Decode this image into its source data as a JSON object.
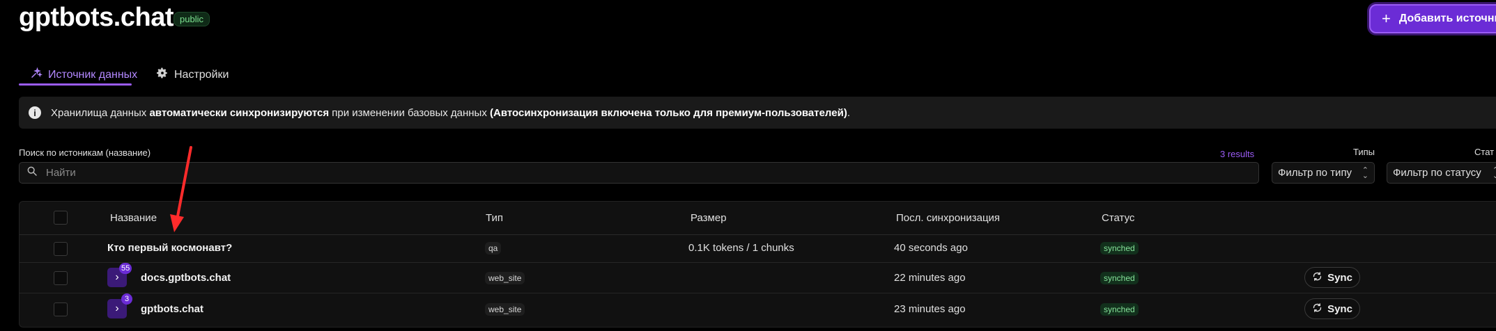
{
  "header": {
    "site_title": "gptbots.chat",
    "visibility_badge": "public",
    "add_source_label": "Добавить источник"
  },
  "tabs": [
    {
      "label": "Источник данных",
      "icon": "sparkles-icon",
      "active": true
    },
    {
      "label": "Настройки",
      "icon": "gear-icon",
      "active": false
    }
  ],
  "banner": {
    "text_1": "Хранилища данных ",
    "bold_1": "автоматически синхронизируются",
    "text_2": " при изменении базовых данных ",
    "bold_2": "(Автосинхронизация включена только для премиум-пользователей)",
    "text_3": "."
  },
  "search": {
    "label": "Поиск по истоникам (название)",
    "placeholder": "Найти",
    "results": "3 results"
  },
  "filters": {
    "types_label": "Типы",
    "type_select": "Фильтр по типу",
    "status_label": "Стат",
    "status_select": "Фильтр по статусу"
  },
  "table": {
    "columns": [
      "Название",
      "Тип",
      "Размер",
      "Посл. синхронизация",
      "Статус"
    ],
    "rows": [
      {
        "name": "Кто первый космонавт?",
        "type": "qa",
        "size": "0.1K tokens / 1 chunks",
        "last_sync": "40 seconds ago",
        "status": "synched"
      },
      {
        "name": "docs.gptbots.chat",
        "count": "55",
        "type": "web_site",
        "size": "",
        "last_sync": "22 minutes ago",
        "status": "synched",
        "action": "Sync"
      },
      {
        "name": "gptbots.chat",
        "count": "3",
        "type": "web_site",
        "size": "",
        "last_sync": "23 minutes ago",
        "status": "synched",
        "action": "Sync"
      }
    ]
  },
  "colors": {
    "accent": "#9b5cf6",
    "primary_button": "#6b2cd6",
    "status_green": "#86e39a",
    "annotation_arrow": "#ff2b2b"
  }
}
